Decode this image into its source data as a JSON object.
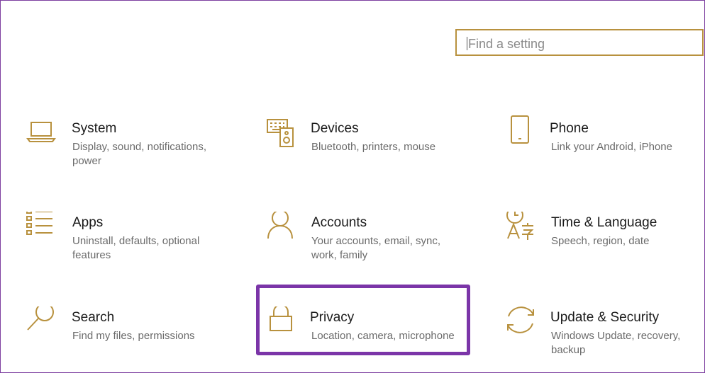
{
  "search": {
    "placeholder": "Find a setting"
  },
  "tiles": [
    {
      "title": "System",
      "desc_line1": "Display, sound, notifications,",
      "desc_line2": "power",
      "icon": "laptop-icon"
    },
    {
      "title": "Devices",
      "desc_line1": "Bluetooth, printers, mouse",
      "desc_line2": "",
      "icon": "devices-icon"
    },
    {
      "title": "Phone",
      "desc_line1": "Link your Android, iPhone",
      "desc_line2": "",
      "icon": "phone-icon"
    },
    {
      "title": "Apps",
      "desc_line1": "Uninstall, defaults, optional",
      "desc_line2": "features",
      "icon": "apps-list-icon"
    },
    {
      "title": "Accounts",
      "desc_line1": "Your accounts, email, sync,",
      "desc_line2": "work, family",
      "icon": "person-icon"
    },
    {
      "title": "Time & Language",
      "desc_line1": "Speech, region, date",
      "desc_line2": "",
      "icon": "time-language-icon"
    },
    {
      "title": "Search",
      "desc_line1": "Find my files, permissions",
      "desc_line2": "",
      "icon": "magnifier-icon"
    },
    {
      "title": "Privacy",
      "desc_line1": "Location, camera, microphone",
      "desc_line2": "",
      "icon": "lock-icon"
    },
    {
      "title": "Update & Security",
      "desc_line1": "Windows Update, recovery,",
      "desc_line2": "backup",
      "icon": "sync-arrows-icon"
    }
  ],
  "highlighted_tile": "Privacy",
  "colors": {
    "accent": "#b8913e",
    "highlight": "#7b35a8",
    "title": "#1a1a1a",
    "desc": "#6b6b6b"
  }
}
